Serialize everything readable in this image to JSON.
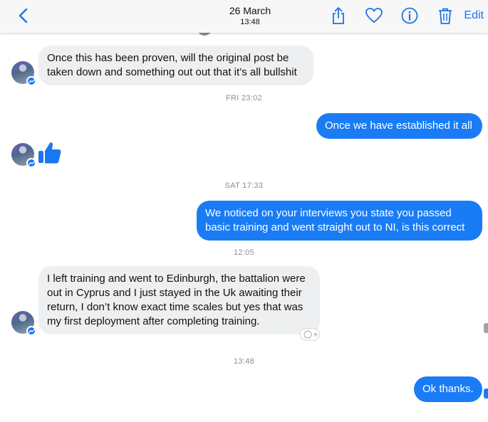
{
  "header": {
    "date": "26 March",
    "time": "13:48",
    "edit_label": "Edit",
    "back_icon": "chevron-left-icon",
    "icons": [
      "share-icon",
      "heart-icon",
      "info-icon",
      "trash-icon"
    ],
    "accent_color": "#1a73e8"
  },
  "messages": {
    "m1": "Once this has been proven, will the original post be taken down and something out out that it’s all bullshit",
    "ts1": "FRI 23:02",
    "m2": "Once we have established it all",
    "m3_reaction": "thumbs-up-icon",
    "ts2": "SAT 17:33",
    "m4": "We noticed on your interviews you state you passed basic training and went straight out to NI, is this correct",
    "ts3": "12:05",
    "m5": "I left training and went to Edinburgh, the battalion were out in Cyprus and I just stayed in the Uk awaiting their return, I don’t know exact time scales but yes that was my first deployment after completing training.",
    "ts4": "13:48",
    "m6": "Ok thanks."
  },
  "colors": {
    "outgoing_bubble": "#1a7cf5",
    "incoming_bubble": "#eeeff1"
  }
}
